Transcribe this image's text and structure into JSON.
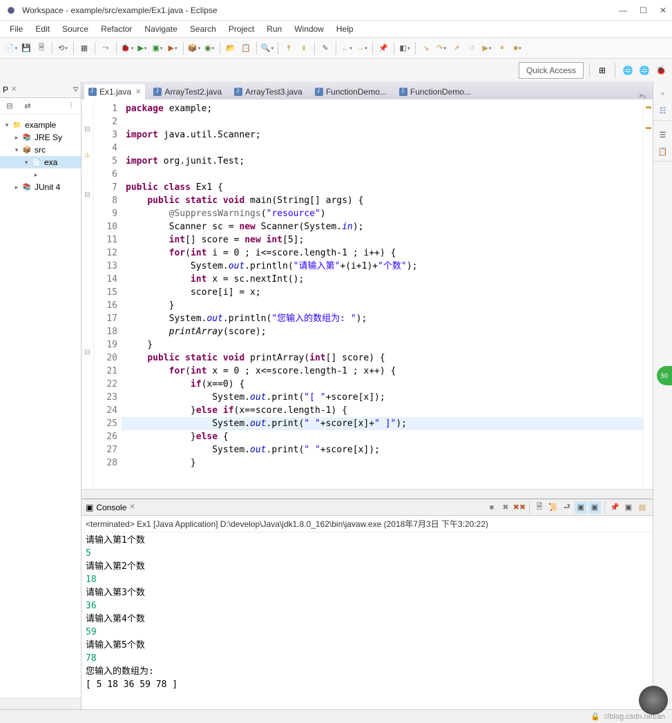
{
  "window": {
    "title": "Workspace - example/src/example/Ex1.java - Eclipse"
  },
  "menu": [
    "File",
    "Edit",
    "Source",
    "Refactor",
    "Navigate",
    "Search",
    "Project",
    "Run",
    "Window",
    "Help"
  ],
  "quick_access": "Quick Access",
  "left": {
    "tab": "P",
    "tree": [
      {
        "depth": 0,
        "arrow": "▾",
        "icon": "📁",
        "label": "example"
      },
      {
        "depth": 1,
        "arrow": "▸",
        "icon": "📚",
        "label": "JRE Sy"
      },
      {
        "depth": 1,
        "arrow": "▾",
        "icon": "📦",
        "label": "src"
      },
      {
        "depth": 2,
        "arrow": "▾",
        "icon": "📄",
        "label": "exa",
        "sel": true
      },
      {
        "depth": 3,
        "arrow": "▸",
        "icon": "",
        "label": ""
      },
      {
        "depth": 1,
        "arrow": "▸",
        "icon": "📚",
        "label": "JUnit 4"
      }
    ]
  },
  "tabs": [
    {
      "label": "Ex1.java",
      "active": true,
      "close": true
    },
    {
      "label": "ArrayTest2.java",
      "active": false
    },
    {
      "label": "ArrayTest3.java",
      "active": false
    },
    {
      "label": "FunctionDemo...",
      "active": false
    },
    {
      "label": "FunctionDemo...",
      "active": false
    }
  ],
  "tabs_overflow": "»₃",
  "code": {
    "lines": [
      {
        "n": 1,
        "html": "<span class='kw'>package</span> example;"
      },
      {
        "n": 2,
        "html": ""
      },
      {
        "n": 3,
        "html": "<span class='kw'>import</span> java.util.Scanner;",
        "fold": true
      },
      {
        "n": 4,
        "html": ""
      },
      {
        "n": 5,
        "html": "<span class='kw'>import</span> org.junit.Test;",
        "warn": true
      },
      {
        "n": 6,
        "html": ""
      },
      {
        "n": 7,
        "html": "<span class='kw'>public</span> <span class='kw'>class</span> Ex1 {"
      },
      {
        "n": 8,
        "html": "    <span class='kw'>public</span> <span class='kw'>static</span> <span class='kw'>void</span> main(String[] args) {",
        "fold": true
      },
      {
        "n": 9,
        "html": "        <span class='ann'>@SuppressWarnings</span>(<span class='str'>\"resource\"</span>)"
      },
      {
        "n": 10,
        "html": "        Scanner sc = <span class='kw'>new</span> Scanner(System.<span class='fld'>in</span>);"
      },
      {
        "n": 11,
        "html": "        <span class='kw'>int</span>[] score = <span class='kw'>new</span> <span class='kw'>int</span>[5];"
      },
      {
        "n": 12,
        "html": "        <span class='kw'>for</span>(<span class='kw'>int</span> i = 0 ; i&lt;=score.length-1 ; i++) {"
      },
      {
        "n": 13,
        "html": "            System.<span class='fld'>out</span>.println(<span class='str'>\"请输入第\"</span>+(i+1)+<span class='str'>\"个数\"</span>);"
      },
      {
        "n": 14,
        "html": "            <span class='kw'>int</span> x = sc.nextInt();"
      },
      {
        "n": 15,
        "html": "            score[i] = x;"
      },
      {
        "n": 16,
        "html": "        }"
      },
      {
        "n": 17,
        "html": "        System.<span class='fld'>out</span>.println(<span class='str'>\"您输入的数组为: \"</span>);"
      },
      {
        "n": 18,
        "html": "        <span style='font-style:italic'>printArray</span>(score);"
      },
      {
        "n": 19,
        "html": "    }"
      },
      {
        "n": 20,
        "html": "    <span class='kw'>public</span> <span class='kw'>static</span> <span class='kw'>void</span> printArray(<span class='kw'>int</span>[] score) {",
        "fold": true
      },
      {
        "n": 21,
        "html": "        <span class='kw'>for</span>(<span class='kw'>int</span> x = 0 ; x&lt;=score.length-1 ; x++) {"
      },
      {
        "n": 22,
        "html": "            <span class='kw'>if</span>(x==0) {"
      },
      {
        "n": 23,
        "html": "                System.<span class='fld'>out</span>.print(<span class='str'>\"[ \"</span>+score[x]);"
      },
      {
        "n": 24,
        "html": "            }<span class='kw'>else</span> <span class='kw'>if</span>(x==score.length-1) {"
      },
      {
        "n": 25,
        "html": "                System.<span class='fld'>out</span>.print(<span class='str'>\" \"</span>+score[x]+<span class='str'>\" ]\"</span>);",
        "cur": true
      },
      {
        "n": 26,
        "html": "            }<span class='kw'>else</span> {"
      },
      {
        "n": 27,
        "html": "                System.<span class='fld'>out</span>.print(<span class='str'>\" \"</span>+score[x]);"
      },
      {
        "n": 28,
        "html": "            }"
      }
    ]
  },
  "console": {
    "tab": "Console",
    "status": "<terminated> Ex1 [Java Application] D:\\develop\\Java\\jdk1.8.0_162\\bin\\javaw.exe (2018年7月3日 下午3:20:22)",
    "lines": [
      {
        "t": "请输入第1个数"
      },
      {
        "t": "5",
        "inp": true
      },
      {
        "t": "请输入第2个数"
      },
      {
        "t": "18",
        "inp": true
      },
      {
        "t": "请输入第3个数"
      },
      {
        "t": "36",
        "inp": true
      },
      {
        "t": "请输入第4个数"
      },
      {
        "t": "59",
        "inp": true
      },
      {
        "t": "请输入第5个数"
      },
      {
        "t": "78",
        "inp": true
      },
      {
        "t": "您输入的数组为: "
      },
      {
        "t": "[ 5 18 36 59 78 ]"
      }
    ]
  },
  "footer_url": "://blog.csdn.net/an"
}
